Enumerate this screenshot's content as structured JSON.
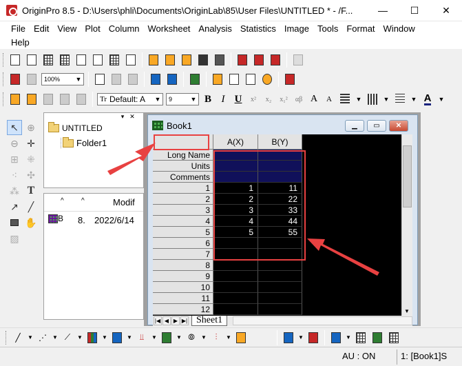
{
  "window": {
    "title": "OriginPro 8.5 - D:\\Users\\phli\\Documents\\OriginLab\\85\\User Files\\UNTITLED * - /F...",
    "minimize": "—",
    "maximize": "☐",
    "close": "✕"
  },
  "menu": {
    "row1": [
      "File",
      "Edit",
      "View",
      "Plot",
      "Column",
      "Worksheet",
      "Analysis",
      "Statistics",
      "Image",
      "Tools",
      "Format",
      "Window"
    ],
    "row2": [
      "Help"
    ]
  },
  "toolbar": {
    "zoom_value": "100%",
    "font_name": "Default: A",
    "font_prefix": "Tr",
    "font_size": "9",
    "bold": "B",
    "italic": "I",
    "underline": "U",
    "superscript": "x²",
    "subscript": "x₂",
    "supsub": "x₁²",
    "alpha_beta": "αβ",
    "enlarge": "A",
    "reduce": "A"
  },
  "explorer": {
    "root": "UNTITLED",
    "folder": "Folder1",
    "close": "✕",
    "pin": "▾"
  },
  "filelist": {
    "header_modified": "Modif",
    "item_name": "B",
    "item_size": "8.",
    "item_date": "2022/6/14"
  },
  "book": {
    "title": "Book1",
    "sheet_tab": "Sheet1",
    "columns": [
      "A(X)",
      "B(Y)"
    ],
    "meta_rows": [
      "Long Name",
      "Units",
      "Comments"
    ],
    "row_numbers": [
      "1",
      "2",
      "3",
      "4",
      "5",
      "6",
      "7",
      "8",
      "9",
      "10",
      "11",
      "12"
    ],
    "data": [
      [
        "1",
        "11"
      ],
      [
        "2",
        "22"
      ],
      [
        "3",
        "33"
      ],
      [
        "4",
        "44"
      ],
      [
        "5",
        "55"
      ],
      [
        "",
        ""
      ],
      [
        "",
        ""
      ],
      [
        "",
        ""
      ],
      [
        "",
        ""
      ],
      [
        "",
        ""
      ],
      [
        "",
        ""
      ],
      [
        "",
        ""
      ]
    ]
  },
  "status": {
    "au": "AU : ON",
    "active": "1: [Book1]S"
  },
  "annotation_color": "#e84141"
}
